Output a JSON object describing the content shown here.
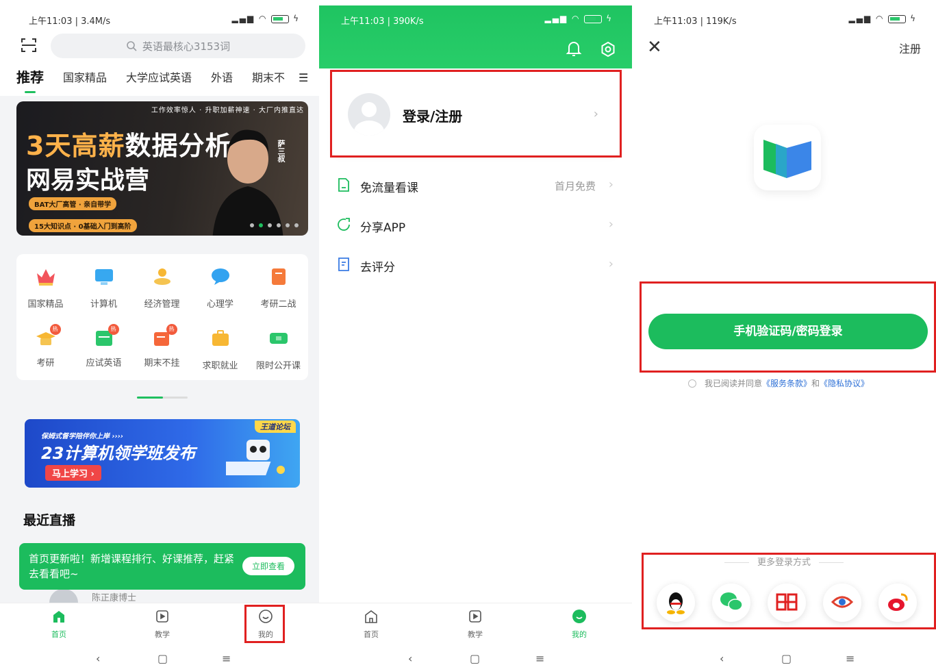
{
  "panel1": {
    "status": {
      "time": "上午11:03 | 3.4M/s",
      "battery": "61"
    },
    "search": {
      "placeholder": "英语最核心3153词"
    },
    "tabs": [
      "推荐",
      "国家精品",
      "大学应试英语",
      "外语",
      "期末不"
    ],
    "banner": {
      "tagline": "工作效率惊人 · 升职加薪神速 · 大厂内推直达",
      "title_hl": "3天高薪",
      "title_rest": "数据分析",
      "title2": "网易实战营",
      "chip1": "BAT大厂高管 · 亲自带学",
      "chip2": "15大知识点 · 0基础入门到高阶",
      "side": "萨三叔"
    },
    "categories": [
      {
        "label": "国家精品",
        "icon": "crown-icon",
        "hot": false
      },
      {
        "label": "计算机",
        "icon": "monitor-icon",
        "hot": false
      },
      {
        "label": "经济管理",
        "icon": "coins-icon",
        "hot": false
      },
      {
        "label": "心理学",
        "icon": "chat-bubble-icon",
        "hot": false
      },
      {
        "label": "考研二战",
        "icon": "notebook-icon",
        "hot": false
      },
      {
        "label": "考研",
        "icon": "grad-cap-icon",
        "hot": true
      },
      {
        "label": "应试英语",
        "icon": "cet-icon",
        "hot": true
      },
      {
        "label": "期末不挂",
        "icon": "exam-icon",
        "hot": true
      },
      {
        "label": "求职就业",
        "icon": "briefcase-icon",
        "hot": false
      },
      {
        "label": "限时公开课",
        "icon": "ticket-icon",
        "hot": false
      }
    ],
    "hot_label": "热",
    "ad": {
      "line1": "保姆式督学陪伴你上岸 ››››",
      "line2": "23计算机领学班发布",
      "button": "马上学习 ›",
      "tag": "王道论坛"
    },
    "section_title": "最近直播",
    "toast": {
      "message": "首页更新啦！新增课程排行、好课推荐，赶紧去看看吧~",
      "button": "立即查看"
    },
    "teacher": "陈正康博士",
    "nav": [
      "首页",
      "教学",
      "我的"
    ]
  },
  "panel2": {
    "status": {
      "time": "上午11:03 | 390K/s",
      "battery": "61"
    },
    "login_label": "登录/注册",
    "menu": [
      {
        "label": "免流量看课",
        "right": "首月免费",
        "icon": "sim-card-icon"
      },
      {
        "label": "分享APP",
        "right": "",
        "icon": "share-icon"
      },
      {
        "label": "去评分",
        "right": "",
        "icon": "rate-icon"
      }
    ],
    "nav": [
      "首页",
      "教学",
      "我的"
    ]
  },
  "panel3": {
    "status": {
      "time": "上午11:03 | 119K/s",
      "battery": "61"
    },
    "register": "注册",
    "login_button": "手机验证码/密码登录",
    "agree_prefix": "我已阅读并同意",
    "terms": "《服务条款》",
    "agree_and": "和",
    "privacy": "《隐私协议》",
    "more_label": "更多登录方式",
    "socials": [
      "qq-icon",
      "wechat-icon",
      "netease-mail-icon",
      "eye-icon",
      "weibo-icon"
    ]
  },
  "sysbar": {
    "back": "‹",
    "home": "▢",
    "menu": "≡"
  },
  "colors": {
    "brand_green": "#1cbc5d",
    "highlight_red": "#e02020"
  }
}
